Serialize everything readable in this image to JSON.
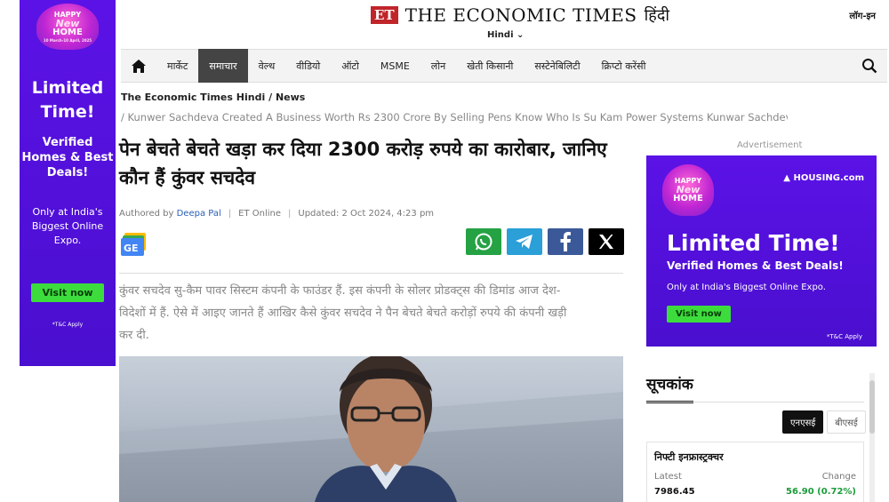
{
  "left_ad": {
    "badge_line1": "HAPPY",
    "badge_line2": "New",
    "badge_line3": "HOME",
    "badge_dates": "10 March-10 April, 2025",
    "headline": "Limited Time!",
    "subline": "Verified Homes & Best Deals!",
    "expo": "Only at India's Biggest Online Expo.",
    "cta": "Visit now",
    "tc": "*T&C Apply"
  },
  "header": {
    "logo_et": "ET",
    "logo_name": "THE ECONOMIC TIMES",
    "logo_hindi": "हिंदी",
    "edition": "Hindi",
    "login": "लॉग-इन"
  },
  "nav": {
    "items": [
      "मार्केट",
      "समाचार",
      "वेल्थ",
      "वीडियो",
      "ऑटो",
      "MSME",
      "लोन",
      "खेती किसानी",
      "सस्टेनेबिलिटी",
      "क्रिप्टो करेंसी"
    ],
    "active_index": 1
  },
  "breadcrumb": {
    "site": "The Economic Times Hindi",
    "section": "News",
    "slug": "Kunwer Sachdeva Created A Business Worth Rs 2300 Crore By Selling Pens Know Who Is Su Kam Power Systems Kunwar Sachdev"
  },
  "article": {
    "headline": "पेन बेचते बेचते खड़ा कर दिया 2300 करोड़ रुपये का कारोबार, जानिए कौन हैं कुंवर सचदेव",
    "authored_by": "Authored by",
    "author": "Deepa Pal",
    "source": "ET Online",
    "updated": "Updated: 2 Oct 2024, 4:23 pm",
    "summary": "कुंवर सचदेव सु-कैम पावर सिस्टम कंपनी के फाउंडर हैं. इस कंपनी के सोलर प्रोडक्ट्स की डिमांड आज देश-विदेशों में हैं. ऐसे में आइए जानते हैं आखिर कैसे कुंवर सचदेव ने पैन बेचते बेचते करोड़ों रुपये की कंपनी खड़ी कर दी."
  },
  "share": {
    "icons": [
      "whatsapp-icon",
      "telegram-icon",
      "facebook-icon",
      "x-icon"
    ],
    "colors": [
      "#25a244",
      "#2a9fd8",
      "#3b5998",
      "#000000"
    ]
  },
  "right_ad": {
    "label": "Advertisement",
    "brand": "HOUSING.com",
    "headline": "Limited Time!",
    "subline": "Verified Homes & Best Deals!",
    "expo": "Only at India's Biggest Online Expo.",
    "cta": "Visit now",
    "tc": "*T&C Apply"
  },
  "indices": {
    "title": "सूचकांक",
    "tabs": [
      "एनएसई",
      "बीएसई"
    ],
    "active_tab": 0,
    "card": {
      "name": "निफ्टी इनफ्रास्ट्रक्चर",
      "latest_label": "Latest",
      "change_label": "Change",
      "latest": "7986.45",
      "change": "56.90 (0.72%)"
    }
  },
  "colors": {
    "brand_red": "#c0252a",
    "ad_purple": "#5b12e6",
    "positive_green": "#1a9c3a",
    "nav_active": "#444444"
  }
}
